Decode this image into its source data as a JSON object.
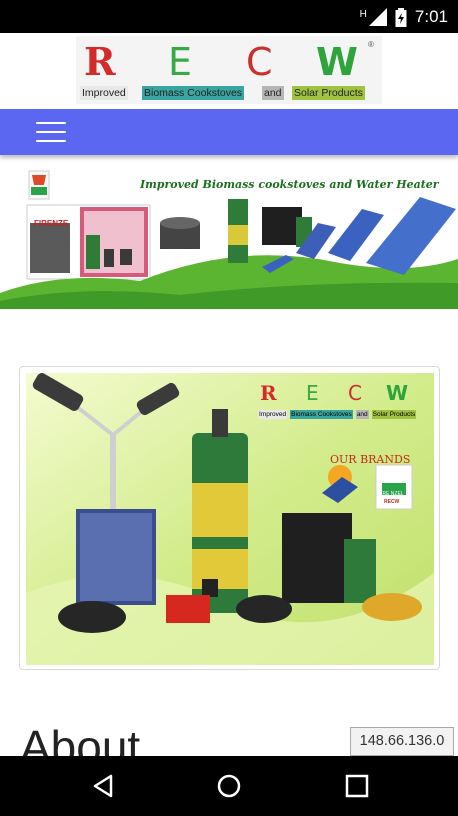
{
  "status_bar": {
    "time": "7:01",
    "network_label": "H",
    "icons": [
      "signal-icon",
      "battery-icon"
    ]
  },
  "logo": {
    "letters": [
      "R",
      "E",
      "C",
      "W"
    ],
    "tags": [
      "Improved",
      "Biomass Cookstoves",
      "and",
      "Solar Products"
    ],
    "colors": {
      "r": "#d42a2a",
      "e": "#3aa844",
      "c": "#c9302c",
      "w": "#2fa43a",
      "tag_bg": "#3aa5a0",
      "tag_bg2": "#9fc240"
    }
  },
  "navbar": {
    "menu_icon": "hamburger-icon",
    "color": "#5b67f0"
  },
  "hero": {
    "title": "Improved Biomass cookstoves and Water Heater",
    "badge_text": "FIRENZE"
  },
  "product_card": {
    "brand_letters": [
      "R",
      "E",
      "C",
      "W"
    ],
    "brand_tags": [
      "Improved",
      "Biomass Cookstoves",
      "and",
      "Solar Products"
    ],
    "brands_label": "OUR BRANDS",
    "brand_logo_text": "FIRE NZEL",
    "brand_logo_sub": "RECW"
  },
  "content": {
    "heading": "About"
  },
  "overlay": {
    "ip_address": "148.66.136.0"
  },
  "nav_buttons": [
    "back-icon",
    "home-icon",
    "recents-icon"
  ]
}
